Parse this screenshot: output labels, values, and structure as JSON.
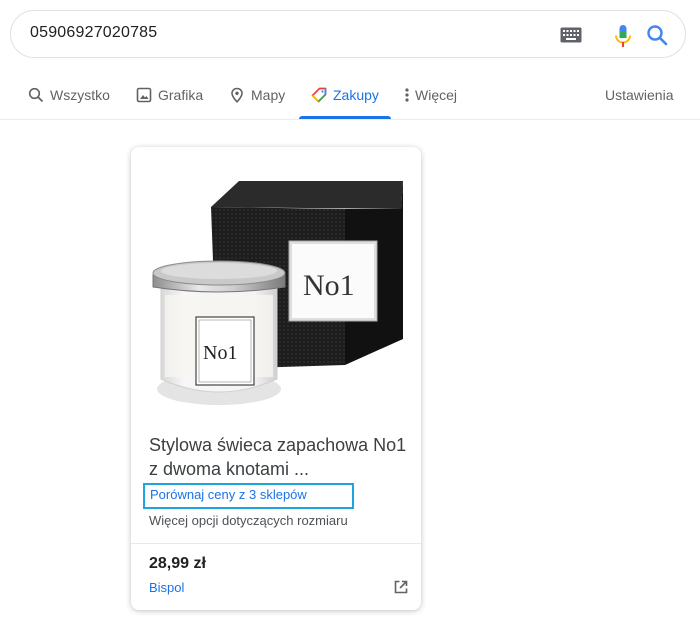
{
  "search": {
    "query": "05906927020785",
    "icons": [
      "keyboard-icon",
      "microphone-icon",
      "search-icon"
    ]
  },
  "tabs": [
    {
      "label": "Wszystko",
      "icon": "search-icon",
      "active": false
    },
    {
      "label": "Grafika",
      "icon": "image-icon",
      "active": false
    },
    {
      "label": "Mapy",
      "icon": "map-pin-icon",
      "active": false
    },
    {
      "label": "Zakupy",
      "icon": "tag-icon",
      "active": true
    },
    {
      "label": "Więcej",
      "icon": "more-vertical-icon",
      "active": false
    }
  ],
  "settings_label": "Ustawienia",
  "product": {
    "title_line1": "Stylowa świeca zapachowa No1",
    "title_line2": "z dwoma knotami ...",
    "compare_link": "Porównaj ceny z 3 sklepów",
    "size_options": "Więcej opcji dotyczących rozmiaru",
    "price": "28,99 zł",
    "merchant": "Bispol",
    "image_label_candle": "No1",
    "image_label_box": "No1"
  },
  "colors": {
    "accent": "#1a73e8",
    "highlight_border": "#1ea5e0",
    "text_primary": "#202124",
    "text_secondary": "#5f6368"
  }
}
